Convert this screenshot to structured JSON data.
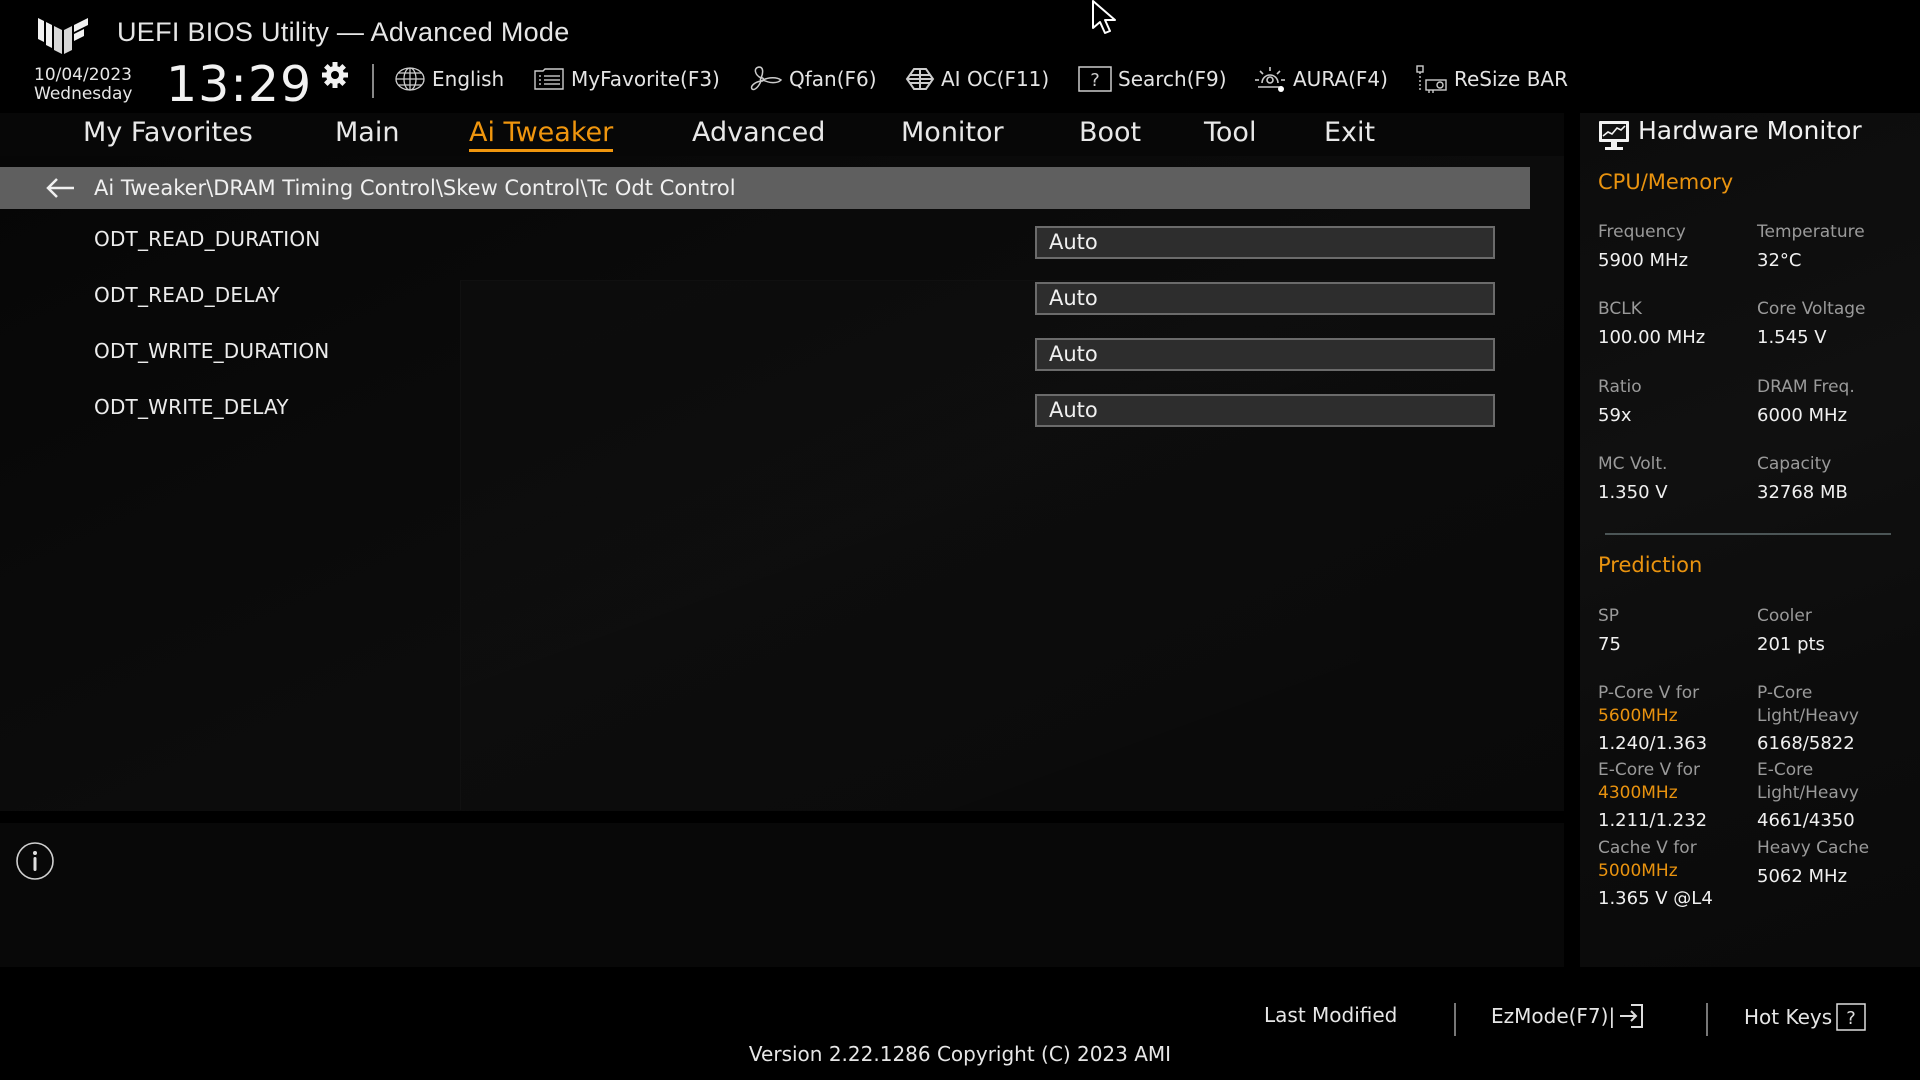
{
  "header": {
    "title": "UEFI BIOS Utility — Advanced Mode",
    "date": "10/04/2023",
    "day": "Wednesday",
    "time": "13:29"
  },
  "toolbar": [
    {
      "label": "English",
      "icon": "globe-icon"
    },
    {
      "label": "MyFavorite(F3)",
      "icon": "favorite-list-icon"
    },
    {
      "label": "Qfan(F6)",
      "icon": "fan-icon"
    },
    {
      "label": "AI OC(F11)",
      "icon": "ai-oc-icon"
    },
    {
      "label": "Search(F9)",
      "icon": "search-help-icon"
    },
    {
      "label": "AURA(F4)",
      "icon": "aura-light-icon"
    },
    {
      "label": "ReSize BAR",
      "icon": "resize-bar-icon"
    }
  ],
  "nav": {
    "tabs": [
      "My Favorites",
      "Main",
      "Ai Tweaker",
      "Advanced",
      "Monitor",
      "Boot",
      "Tool",
      "Exit"
    ],
    "active": "Ai Tweaker"
  },
  "breadcrumb": "Ai Tweaker\\DRAM Timing Control\\Skew Control\\Tc Odt Control",
  "settings": [
    {
      "label": "ODT_READ_DURATION",
      "value": "Auto"
    },
    {
      "label": "ODT_READ_DELAY",
      "value": "Auto"
    },
    {
      "label": "ODT_WRITE_DURATION",
      "value": "Auto"
    },
    {
      "label": "ODT_WRITE_DELAY",
      "value": "Auto"
    }
  ],
  "hardware_monitor": {
    "title": "Hardware Monitor",
    "cpu_memory": {
      "title": "CPU/Memory",
      "items": [
        {
          "label": "Frequency",
          "value": "5900 MHz"
        },
        {
          "label": "Temperature",
          "value": "32°C"
        },
        {
          "label": "BCLK",
          "value": "100.00 MHz"
        },
        {
          "label": "Core Voltage",
          "value": "1.545 V"
        },
        {
          "label": "Ratio",
          "value": "59x"
        },
        {
          "label": "DRAM Freq.",
          "value": "6000 MHz"
        },
        {
          "label": "MC Volt.",
          "value": "1.350 V"
        },
        {
          "label": "Capacity",
          "value": "32768 MB"
        }
      ]
    },
    "prediction": {
      "title": "Prediction",
      "sp_label": "SP",
      "sp_value": "75",
      "cooler_label": "Cooler",
      "cooler_value": "201 pts",
      "pcore_v_label": "P-Core V for",
      "pcore_v_freq": "5600MHz",
      "pcore_v_value": "1.240/1.363",
      "pcore_lh_label1": "P-Core",
      "pcore_lh_label2": "Light/Heavy",
      "pcore_lh_value": "6168/5822",
      "ecore_v_label": "E-Core V for",
      "ecore_v_freq": "4300MHz",
      "ecore_v_value": "1.211/1.232",
      "ecore_lh_label1": "E-Core",
      "ecore_lh_label2": "Light/Heavy",
      "ecore_lh_value": "4661/4350",
      "cache_v_label": "Cache V for",
      "cache_v_freq": "5000MHz",
      "cache_v_value": "1.365 V @L4",
      "heavy_cache_label": "Heavy Cache",
      "heavy_cache_value": "5062 MHz"
    }
  },
  "footer": {
    "last_modified": "Last Modified",
    "ezmode": "EzMode(F7)|",
    "hotkeys": "Hot Keys",
    "version": "Version 2.22.1286 Copyright (C) 2023 AMI"
  },
  "colors": {
    "accent": "#f0960e",
    "breadcrumb_bg": "#5f5f5f",
    "dropdown_bg": "#2d2d2d"
  }
}
